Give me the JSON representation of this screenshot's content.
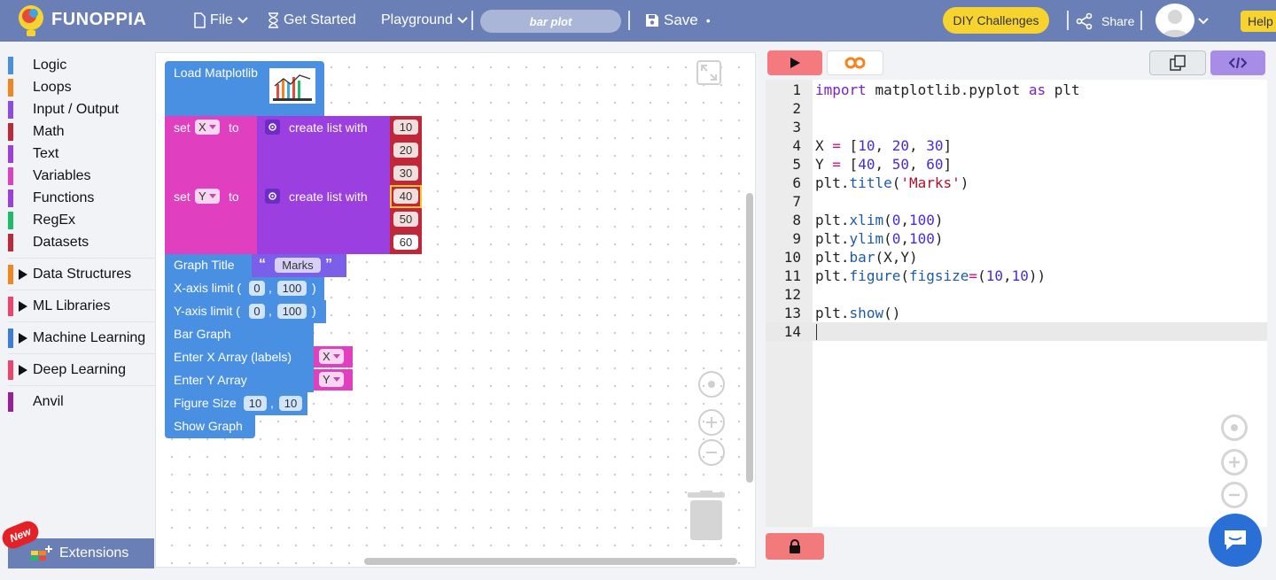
{
  "header": {
    "brand": "FUNOPPIA",
    "menu_file": "File",
    "menu_get_started": "Get Started",
    "menu_playground": "Playground",
    "project_name": "bar plot",
    "save_label": "Save",
    "save_status": "•",
    "diy_challenges": "DIY Challenges",
    "share_label": "Share",
    "help_label": "Help"
  },
  "sidebar": {
    "categories": [
      {
        "label": "Logic",
        "color": "#4a90e2"
      },
      {
        "label": "Loops",
        "color": "#f5841f"
      },
      {
        "label": "Input / Output",
        "color": "#8a4be6"
      },
      {
        "label": "Math",
        "color": "#c0283a"
      },
      {
        "label": "Text",
        "color": "#9b3fe0"
      },
      {
        "label": "Variables",
        "color": "#e040c0"
      },
      {
        "label": "Functions",
        "color": "#9b3fe0"
      },
      {
        "label": "RegEx",
        "color": "#1bbd6a"
      },
      {
        "label": "Datasets",
        "color": "#c0283a"
      }
    ],
    "groups": [
      {
        "label": "Data Structures",
        "color": "#f5841f"
      },
      {
        "label": "ML Libraries",
        "color": "#f0436b"
      },
      {
        "label": "Machine Learning",
        "color": "#3b7ddd"
      },
      {
        "label": "Deep Learning",
        "color": "#f0436b"
      },
      {
        "label": "Anvil",
        "color": "#9c1c9c"
      }
    ],
    "extensions_label": "Extensions",
    "new_badge": "New"
  },
  "blocks": {
    "load": "Load Matplotlib",
    "set_label": "set",
    "to_label": "to",
    "var_x": "X",
    "var_y": "Y",
    "create_list": "create list with",
    "x_values": [
      "10",
      "20",
      "30"
    ],
    "y_values": [
      "40",
      "50",
      "60"
    ],
    "graph_title": "Graph Title",
    "title_value": "Marks",
    "open_quote": "“",
    "close_quote": "”",
    "xaxis": "X-axis limit (",
    "yaxis": "Y-axis limit (",
    "comma": ",",
    "close_paren": ")",
    "xlim": [
      "0",
      "100"
    ],
    "ylim": [
      "0",
      "100"
    ],
    "bar_graph": "Bar Graph",
    "enter_x": "Enter X Array (labels)",
    "enter_y": "Enter Y Array",
    "figure_size": "Figure Size",
    "fig_size": [
      "10",
      "10"
    ],
    "show_graph": "Show Graph"
  },
  "editor": {
    "line_numbers": [
      "1",
      "2",
      "3",
      "4",
      "5",
      "6",
      "7",
      "8",
      "9",
      "10",
      "11",
      "12",
      "13",
      "14"
    ],
    "active_line": 14,
    "code": {
      "import_kw": "import",
      "module": "matplotlib.pyplot",
      "as_kw": "as",
      "alias": "plt",
      "x_var": "X",
      "y_var": "Y",
      "eq": "=",
      "x_nums": [
        "10",
        "20",
        "30"
      ],
      "y_nums": [
        "40",
        "50",
        "60"
      ],
      "plt": "plt",
      "title_fn": "title",
      "title_str": "'Marks'",
      "xlim_fn": "xlim",
      "ylim_fn": "ylim",
      "bar_fn": "bar",
      "bar_args": "(X,Y)",
      "figure_fn": "figure",
      "figsize_kw": "figsize",
      "figsize_nums": [
        "10",
        "10"
      ],
      "show_fn": "show",
      "zero": "0",
      "hundred": "100"
    }
  },
  "colors": {
    "header_bg": "#6a7fb5",
    "accent_yellow": "#f7d330",
    "run_red": "#f47a80",
    "code_purple": "#a78ce8"
  }
}
